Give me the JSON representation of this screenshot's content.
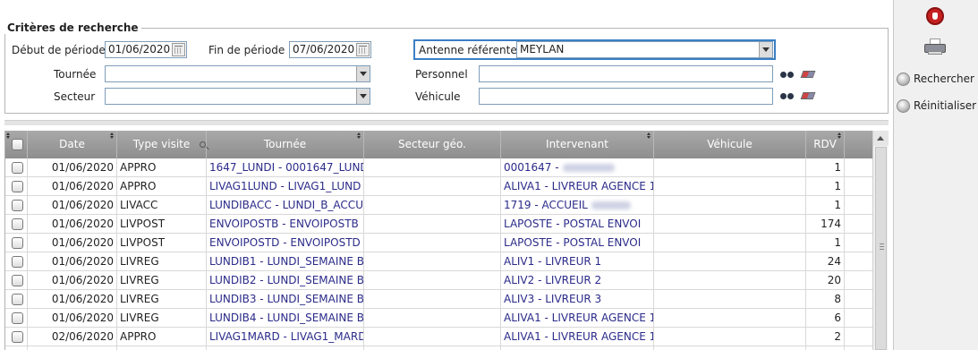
{
  "criteria": {
    "legend": "Critères de recherche",
    "debut_label": "Début de période",
    "debut_value": "01/06/2020",
    "fin_label": "Fin de période",
    "fin_value": "07/06/2020",
    "antenne_label": "Antenne référente",
    "antenne_value": "MEYLAN",
    "tournee_label": "Tournée",
    "tournee_value": "",
    "secteur_label": "Secteur",
    "secteur_value": "",
    "personnel_label": "Personnel",
    "personnel_value": "",
    "vehicule_label": "Véhicule",
    "vehicule_value": ""
  },
  "table": {
    "columns": [
      "Date",
      "Type visite",
      "Tournée",
      "Secteur géo.",
      "Intervenant",
      "Véhicule",
      "RDV"
    ],
    "rows": [
      {
        "date": "01/06/2020",
        "type": "APPRO",
        "tournee": "1647_LUNDI - 0001647_LUND",
        "secteur": "",
        "intervenant": "0001647 -",
        "vehicule": "",
        "rdv": "1"
      },
      {
        "date": "01/06/2020",
        "type": "APPRO",
        "tournee": "LIVAG1LUND - LIVAG1_LUND",
        "secteur": "",
        "intervenant": "ALIVA1 - LIVREUR AGENCE 1",
        "vehicule": "",
        "rdv": "1"
      },
      {
        "date": "01/06/2020",
        "type": "LIVACC",
        "tournee": "LUNDIBACC - LUNDI_B_ACCU",
        "secteur": "",
        "intervenant": "1719 - ACCUEIL",
        "vehicule": "",
        "rdv": "1"
      },
      {
        "date": "01/06/2020",
        "type": "LIVPOST",
        "tournee": "ENVOIPOSTB - ENVOIPOSTB",
        "secteur": "",
        "intervenant": "LAPOSTE - POSTAL ENVOI",
        "vehicule": "",
        "rdv": "174"
      },
      {
        "date": "01/06/2020",
        "type": "LIVPOST",
        "tournee": "ENVOIPOSTD - ENVOIPOSTD",
        "secteur": "",
        "intervenant": "LAPOSTE - POSTAL ENVOI",
        "vehicule": "",
        "rdv": "1"
      },
      {
        "date": "01/06/2020",
        "type": "LIVREG",
        "tournee": "LUNDIB1 - LUNDI_SEMAINE B",
        "secteur": "",
        "intervenant": "ALIV1 - LIVREUR 1",
        "vehicule": "",
        "rdv": "24"
      },
      {
        "date": "01/06/2020",
        "type": "LIVREG",
        "tournee": "LUNDIB2 - LUNDI_SEMAINE B",
        "secteur": "",
        "intervenant": "ALIV2 - LIVREUR 2",
        "vehicule": "",
        "rdv": "20"
      },
      {
        "date": "01/06/2020",
        "type": "LIVREG",
        "tournee": "LUNDIB3 - LUNDI_SEMAINE B",
        "secteur": "",
        "intervenant": "ALIV3 - LIVREUR 3",
        "vehicule": "",
        "rdv": "8"
      },
      {
        "date": "01/06/2020",
        "type": "LIVREG",
        "tournee": "LUNDIB4 - LUNDI_SEMAINE B",
        "secteur": "",
        "intervenant": "ALIVA1 - LIVREUR AGENCE 1",
        "vehicule": "",
        "rdv": "6"
      },
      {
        "date": "02/06/2020",
        "type": "APPRO",
        "tournee": "LIVAG1MARD - LIVAG1_MARD",
        "secteur": "",
        "intervenant": "ALIVA1 - LIVREUR AGENCE 1",
        "vehicule": "",
        "rdv": "2"
      },
      {
        "date": "",
        "type": "",
        "tournee": "",
        "secteur": "",
        "intervenant": "",
        "vehicule": "",
        "rdv": ""
      }
    ]
  },
  "actions": {
    "rechercher": "Rechercher",
    "reinitialiser": "Réinitialiser"
  },
  "icons": {
    "stop": "stop-hand-icon",
    "print": "printer-icon",
    "search": "binoculars-icon",
    "clear": "eraser-icon"
  }
}
